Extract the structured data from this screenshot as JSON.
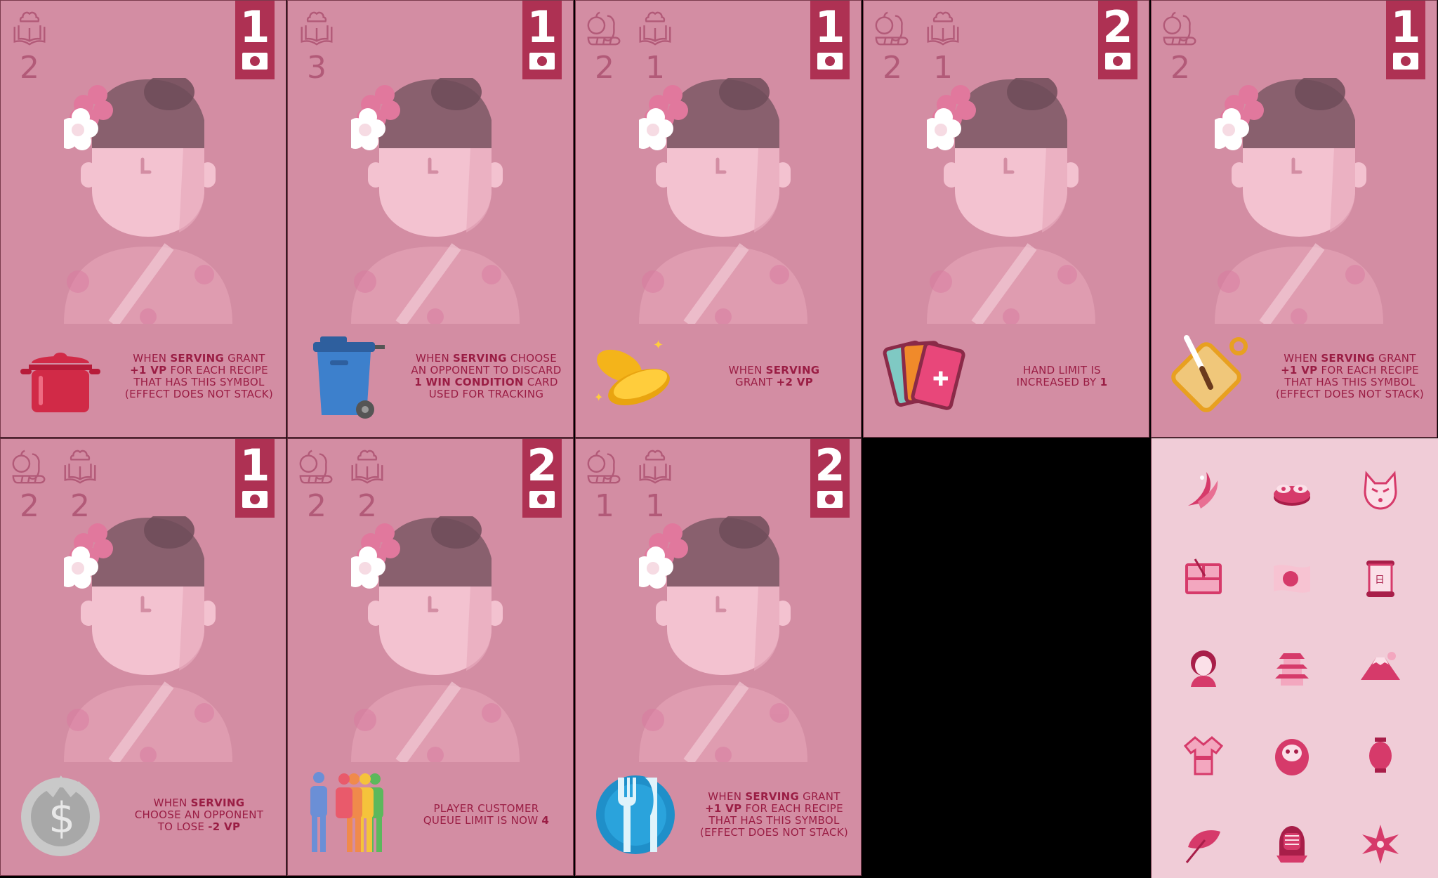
{
  "cards": [
    {
      "requirements": [
        {
          "icon": "cookbook-icon",
          "count": "2"
        }
      ],
      "cost": "1",
      "effect_icon": "cooking-pot-icon",
      "effect": [
        {
          "t": "WHEN "
        },
        {
          "b": "SERVING"
        },
        {
          "t": " GRANT "
        },
        {
          "br": 1
        },
        {
          "b": "+1 VP"
        },
        {
          "t": " FOR EACH RECIPE "
        },
        {
          "br": 1
        },
        {
          "t": "THAT HAS THIS SYMBOL "
        },
        {
          "br": 1
        },
        {
          "t": "(EFFECT DOES NOT STACK)"
        }
      ]
    },
    {
      "requirements": [
        {
          "icon": "cookbook-icon",
          "count": "3"
        }
      ],
      "cost": "1",
      "effect_icon": "trash-bin-icon",
      "effect": [
        {
          "t": "WHEN "
        },
        {
          "b": "SERVING"
        },
        {
          "t": " CHOOSE "
        },
        {
          "br": 1
        },
        {
          "t": "AN OPPONENT TO DISCARD "
        },
        {
          "br": 1
        },
        {
          "b": "1 WIN CONDITION"
        },
        {
          "t": " CARD "
        },
        {
          "br": 1
        },
        {
          "t": "USED FOR TRACKING"
        }
      ]
    },
    {
      "requirements": [
        {
          "icon": "produce-icon",
          "count": "2"
        },
        {
          "icon": "cookbook-icon",
          "count": "1"
        }
      ],
      "cost": "1",
      "effect_icon": "coins-icon",
      "effect": [
        {
          "t": "WHEN "
        },
        {
          "b": "SERVING"
        },
        {
          "br": 1
        },
        {
          "t": "GRANT "
        },
        {
          "b": "+2 VP"
        }
      ]
    },
    {
      "requirements": [
        {
          "icon": "produce-icon",
          "count": "2"
        },
        {
          "icon": "cookbook-icon",
          "count": "1"
        }
      ],
      "cost": "2",
      "effect_icon": "cards-icon",
      "effect": [
        {
          "t": "HAND LIMIT IS "
        },
        {
          "br": 1
        },
        {
          "t": "INCREASED BY "
        },
        {
          "b": "1"
        }
      ]
    },
    {
      "requirements": [
        {
          "icon": "produce-icon",
          "count": "2"
        }
      ],
      "cost": "1",
      "effect_icon": "cutting-board-icon",
      "effect": [
        {
          "t": "WHEN "
        },
        {
          "b": "SERVING"
        },
        {
          "t": " GRANT "
        },
        {
          "br": 1
        },
        {
          "b": "+1 VP"
        },
        {
          "t": " FOR EACH RECIPE "
        },
        {
          "br": 1
        },
        {
          "t": "THAT HAS THIS SYMBOL "
        },
        {
          "br": 1
        },
        {
          "t": "(EFFECT DOES NOT STACK)"
        }
      ]
    },
    {
      "requirements": [
        {
          "icon": "produce-icon",
          "count": "2"
        },
        {
          "icon": "cookbook-icon",
          "count": "2"
        }
      ],
      "cost": "1",
      "effect_icon": "dollar-coin-icon",
      "effect": [
        {
          "t": "WHEN "
        },
        {
          "b": "SERVING"
        },
        {
          "br": 1
        },
        {
          "t": "CHOOSE AN OPPONENT "
        },
        {
          "br": 1
        },
        {
          "t": "TO LOSE "
        },
        {
          "b": "-2 VP"
        }
      ]
    },
    {
      "requirements": [
        {
          "icon": "produce-icon",
          "count": "2"
        },
        {
          "icon": "cookbook-icon",
          "count": "2"
        }
      ],
      "cost": "2",
      "effect_icon": "people-queue-icon",
      "effect": [
        {
          "t": "PLAYER CUSTOMER "
        },
        {
          "br": 1
        },
        {
          "t": "QUEUE LIMIT IS NOW "
        },
        {
          "b": "4"
        }
      ]
    },
    {
      "requirements": [
        {
          "icon": "produce-icon",
          "count": "1"
        },
        {
          "icon": "cookbook-icon",
          "count": "1"
        }
      ],
      "cost": "2",
      "effect_icon": "cutlery-plate-icon",
      "effect": [
        {
          "t": "WHEN "
        },
        {
          "b": "SERVING"
        },
        {
          "t": " GRANT "
        },
        {
          "br": 1
        },
        {
          "b": "+1 VP"
        },
        {
          "t": " FOR EACH RECIPE "
        },
        {
          "br": 1
        },
        {
          "t": "THAT HAS THIS SYMBOL "
        },
        {
          "br": 1
        },
        {
          "t": "(EFFECT DOES NOT STACK)"
        }
      ]
    }
  ],
  "card_back_icons": [
    "koi-fish-icon",
    "sushi-icon",
    "fox-mask-icon",
    "bento-box-icon",
    "japan-flag-icon",
    "scroll-icon",
    "geisha-icon",
    "pagoda-icon",
    "mount-fuji-icon",
    "kimono-icon",
    "daruma-icon",
    "lantern-icon",
    "parasol-icon",
    "kendo-helmet-icon",
    "shuriken-icon"
  ],
  "colors": {
    "card": "#d38da3",
    "badge": "#ae3153",
    "text": "#9a1d44",
    "back": "#f0ccd7"
  }
}
